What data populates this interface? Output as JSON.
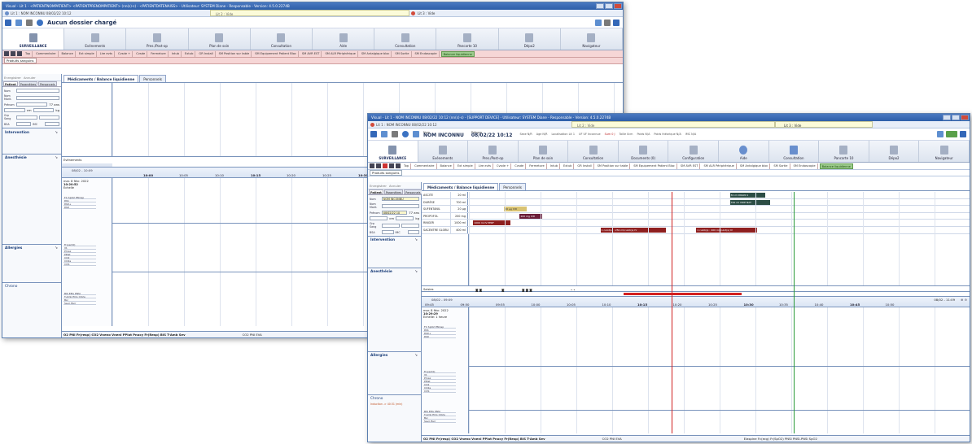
{
  "window1": {
    "title": "Visual - Lit 1 - <PATIENTNOMPATIENT> <PATIENTPRENOMPATIENT> (nn(s)·s) - <PATIENTDATENAISS> -   Utilisateur: SYSTEM Diane - Responsable - Version: 4.5.0.2274B",
    "patient_tab": "Lit 1 : NOM INCONNU 08/02/22 10:12",
    "lit_empty_1": "Lit 2 : Vide",
    "lit_empty_2": "Lit 3 : Vide",
    "status": "Aucun dossier chargé",
    "menu": [
      "SURVEILLANCE",
      "Evénements",
      "Pres./Post-op",
      "Plan de soin",
      "Consultation",
      "Aide",
      "Consultation",
      "Pancarte 10",
      "Dépo2",
      "Navigateur"
    ],
    "toolbar": [
      "Top",
      "Commentaire",
      "Balance",
      "Ext simple",
      "Lire evts",
      "Cvsde +",
      "Cvsde",
      "Fermeture",
      "Intub",
      "Extub",
      "GR Install",
      "SM Position sur table",
      "SM Equipement Patient Bloc",
      "SM AVR EST",
      "SM ALR Périphérique",
      "SM Antalgique bloc",
      "SM Sortie",
      "SM Endoscopie",
      "Balance liquidienne"
    ],
    "produits": "Produits sanguins",
    "left_actions": [
      "Enregistrer",
      "Annuler"
    ],
    "left_tabs": [
      "Patient",
      "Paramètres",
      "Personnels"
    ],
    "fields": {
      "nom": "Nom",
      "nom_marit": "Nom Marit.",
      "prenom": "Prénom",
      "age": "77 ans",
      "cm": "cm",
      "kg": "kg",
      "grp": "Grp Sang",
      "imc": "IMC",
      "bsa": "BSA"
    },
    "sections": [
      "Intervention",
      "Anesthésie",
      "Allergies",
      "Chrono"
    ],
    "main_tabs": [
      "Médicaments / Balance liquidienne",
      "Personnels"
    ],
    "events_label": "Evènements",
    "timeline_range": "08/02 - 10:09",
    "start_label": "mar. 8 févr. 2022",
    "start_time": "10:20:52",
    "echelle": "Echelle",
    "times": [
      "10:00",
      "10:05",
      "10:10",
      "10:15",
      "10:20",
      "10:25",
      "10:30"
    ],
    "param_cols": [
      "FC",
      "SpO2",
      "PNinsp"
    ],
    "param_rows": [
      "PAS",
      "PAD+",
      "PAD"
    ],
    "vent_rows": [
      "Fr(ventil)",
      "Vt.",
      "Pmax",
      "PPlat",
      "CO2",
      "CO2e",
      "COS"
    ],
    "bis_rows": [
      "BIS",
      "EEG",
      "PNSI",
      "T.Amb",
      "ECG",
      "CO2e",
      "Bsr",
      "Sevo",
      "Bsrr"
    ],
    "statusbar": "O2 PNI Fr(resp)   CO2 Vneno Vneni PPlat Pnocy Fr(Resp)   BIS T-Amb Sev",
    "statusbar_mid": "CO2   PNI   EVA"
  },
  "window2": {
    "title": "Visual - Lit 1 - NOM INCONNU 08/02/22 10:12 (nn(s)·s) - [SUPPORT DEVICE] - Utilisateur: SYSTEM Diane - Responsable - Version: 4.5.0.2274B",
    "patient_tab": "Lit 1 : NOM INCONNU 08/02/22 10:12",
    "lit_empty_1": "Lit 2 : Vide",
    "lit_empty_2": "Lit 3 : Vide",
    "nom_label": "Nom",
    "nom_value": "NOM INCONNU",
    "prenom_label": "Prénom",
    "date_value": "08/02/22 10:12",
    "sexe": "Sexe N/R",
    "age": "Age N/R",
    "localisation": "Localisation Lit 1",
    "uf": "UF UF Inconnue",
    "sum": "Sum 0 J",
    "taille": "Taille 0cm",
    "poids": "Poids N/A",
    "poids_ideal": "Poids théorique N/A",
    "imc": "IMC N/A",
    "menu": [
      "SURVEILLANCE",
      "Evénements",
      "Pres./Post-op",
      "Plan de soin",
      "Consultation",
      "Documents (0)",
      "Configuration",
      "Aide",
      "Consultation",
      "Pancarte 10",
      "Dépo2",
      "Navigateur"
    ],
    "toolbar": [
      "Top",
      "Commentaire",
      "Balance",
      "Ext simple",
      "Lire evts",
      "Cvsde +",
      "Cvsde",
      "Fermeture",
      "Intub",
      "Extub",
      "GR Install",
      "SM Position sur table",
      "SM Equipement Patient Bloc",
      "SM AVR EST",
      "SM ALR Périphérique",
      "SM Antalgique bloc",
      "SM Sortie",
      "SM Endoscopie",
      "Balance liquidienne"
    ],
    "produits": "Produits sanguins",
    "left_actions": [
      "Enregistrer",
      "Annuler"
    ],
    "left_tabs": [
      "Patient",
      "Paramètres",
      "Personnels"
    ],
    "fields": {
      "nom": "Nom",
      "nom_val": "NOM INCONNU",
      "nom_marit": "Nom Marit.",
      "prenom": "Prénom",
      "prenom_val": "08/02/22 10",
      "age": "77 ans",
      "cm": "cm",
      "kg": "kg",
      "grp": "Grp Sang",
      "imc": "IMC",
      "bsa": "BSA"
    },
    "sections": [
      "Intervention",
      "Anesthésie",
      "Allergies",
      "Chrono"
    ],
    "main_tabs": [
      "Médicaments / Balance liquidienne",
      "Personnels"
    ],
    "drugs": [
      {
        "name": "ASCITE",
        "dose": "20 ml"
      },
      {
        "name": "DURÈSE",
        "dose": "700 ml"
      },
      {
        "name": "SUFENTANIL",
        "dose": "20 µg"
      },
      {
        "name": "PROPOFOL",
        "dose": "200 mg"
      },
      {
        "name": "RINGER",
        "dose": "1000 ml"
      },
      {
        "name": "SACENTRE GLOBU",
        "dose": "400 ml"
      }
    ],
    "drug_bars": [
      {
        "row": 0,
        "label": "30 ml DRAIN 1",
        "color": "dk",
        "left_pct": 52.2,
        "width_pct": 7
      },
      {
        "row": 1,
        "label": "700 ml VOIE NAT",
        "color": "dk",
        "left_pct": 52.2,
        "width_pct": 8
      },
      {
        "row": 2,
        "label": "20 µg IVD",
        "color": "yl",
        "left_pct": 7.2,
        "width_pct": 4.5
      },
      {
        "row": 3,
        "label": "200 mg IVD",
        "color": "pr",
        "left_pct": 10.3,
        "width_pct": 4.5
      },
      {
        "row": 4,
        "label": "1000 ml IV PERF",
        "color": "rd",
        "left_pct": 1,
        "width_pct": 7.5
      },
      {
        "row": 5,
        "label": "1 culot(s) : 250 ml/culot(s) IV",
        "color": "rd",
        "left_pct": 26.4,
        "width_pct": 13
      },
      {
        "row": 5,
        "label": "1 culot(s) : 400 ml/culot(s) IV",
        "color": "rd",
        "left_pct": 45.5,
        "width_pct": 12.2
      }
    ],
    "saisies_label": "Saisies",
    "timeline_left": "08/02 - 09:09",
    "timeline_right": "08/02 - 11:09",
    "start_label": "mar. 8 févr. 2022",
    "start_time": "10:29:29",
    "echelle": "Echelle: 1 heure",
    "times": [
      "09:45",
      "09:50",
      "09:55",
      "10:00",
      "10:05",
      "10:10",
      "10:15",
      "10:20",
      "10:25",
      "10:30",
      "10:35",
      "10:40",
      "10:45",
      "10:50"
    ],
    "bold_times": [
      "10:15",
      "10:30",
      "10:45"
    ],
    "param_cols": [
      "FC",
      "SpO2",
      "PNinsp"
    ],
    "param_rows": [
      "PAS",
      "PAD+",
      "PAD"
    ],
    "vent_rows": [
      "Fr(ventil)",
      "Vt.",
      "Pmax",
      "PPlat",
      "CO2",
      "CO2e",
      "COS"
    ],
    "bis_rows": [
      "BIS",
      "EEG",
      "PNSI",
      "T.Amb",
      "ECG",
      "CO2e",
      "Bsr",
      "Sevo",
      "Bsrr"
    ],
    "chrono_text": "Induction -> 40:31 (min)",
    "statusbar": "O2 PNI Fr(resp)   CO2 Vneno Vneni PPlat Pnocy Fr(Resp)   BIS T-Amb Sev",
    "statusbar_mid": "CO2   PNI   EVA",
    "statusbar_right": "Elaspine   Fc(ecg) Fr(SpO2) PNSI PNSI-PNSi SpO2"
  }
}
